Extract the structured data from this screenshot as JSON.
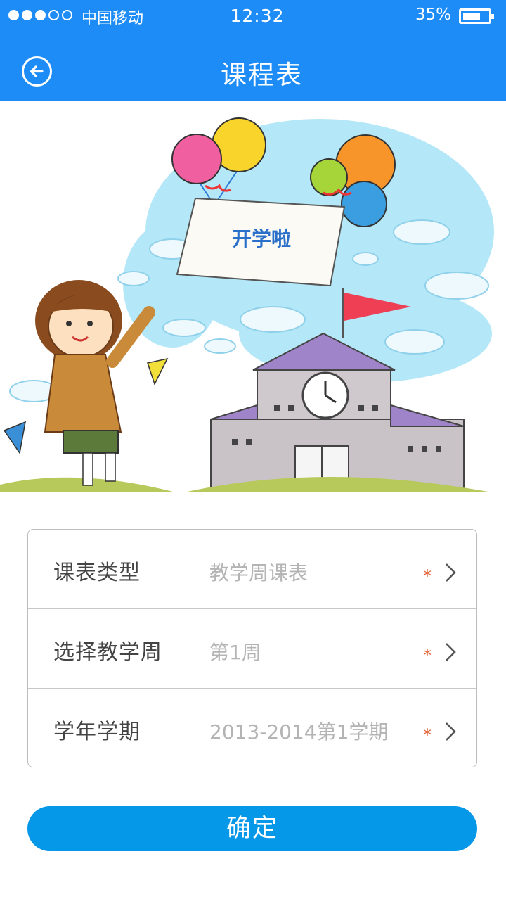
{
  "status_bar": {
    "carrier": "中国移动",
    "time": "12:32",
    "battery_percent": "35%",
    "battery_level": 0.7,
    "signal_total": 5,
    "signal_filled": 3
  },
  "header": {
    "title": "课程表",
    "back_icon": "back-arrow-circle-icon",
    "background": "#1e8cf6"
  },
  "illustration": {
    "banner_text": "开学啦",
    "description_icons": [
      "balloons",
      "girl",
      "school-building",
      "clouds",
      "flag"
    ]
  },
  "form": {
    "rows": [
      {
        "label": "课表类型",
        "value": "教学周课表",
        "required_mark": "*"
      },
      {
        "label": "选择教学周",
        "value": "第1周",
        "required_mark": "*"
      },
      {
        "label": "学年学期",
        "value": "2013-2014第1学期",
        "required_mark": "*"
      }
    ]
  },
  "confirm_button": {
    "label": "确定",
    "color": "#0597e8"
  }
}
